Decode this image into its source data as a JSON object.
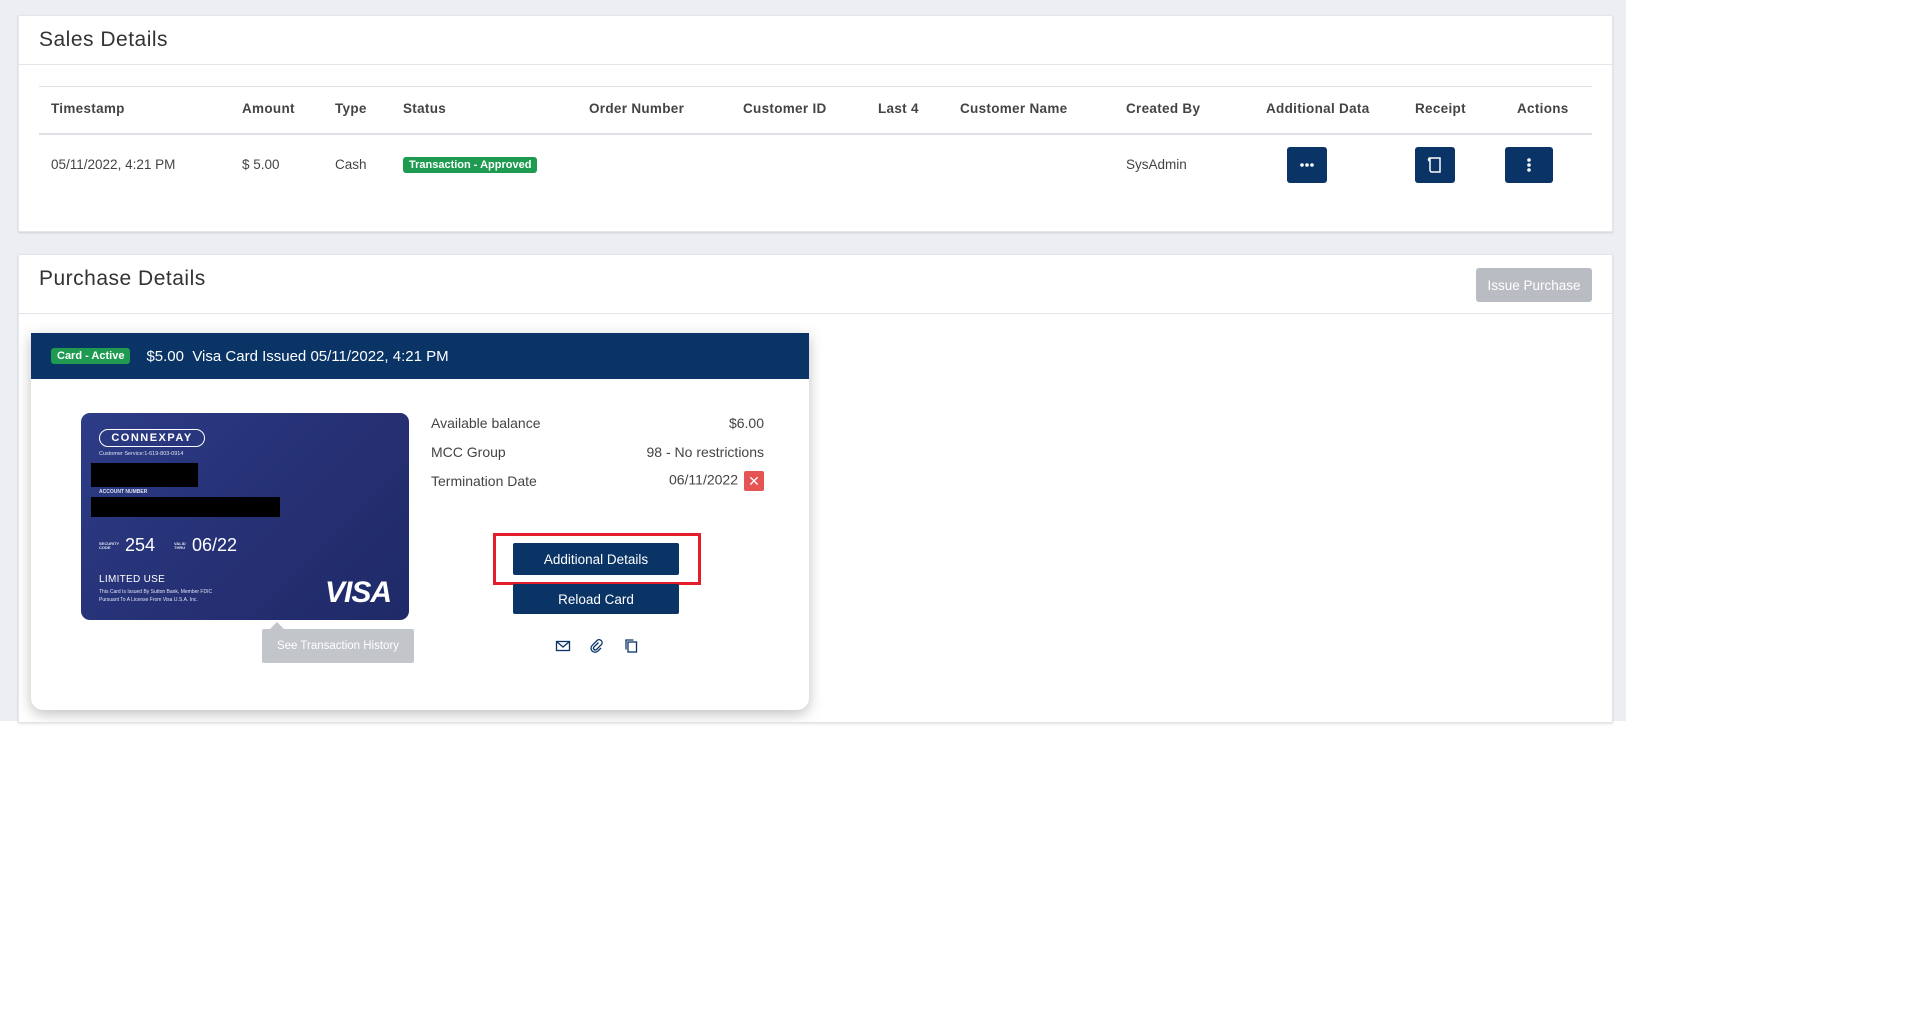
{
  "sales_details": {
    "title": "Sales Details",
    "columns": [
      "Timestamp",
      "Amount",
      "Type",
      "Status",
      "Order Number",
      "Customer ID",
      "Last 4",
      "Customer Name",
      "Created By",
      "Additional Data",
      "Receipt",
      "Actions"
    ],
    "row": {
      "timestamp": "05/11/2022, 4:21 PM",
      "amount": "$ 5.00",
      "type": "Cash",
      "status": "Transaction - Approved",
      "order_number": "",
      "customer_id": "",
      "last4": "",
      "customer_name": "",
      "created_by": "SysAdmin"
    }
  },
  "purchase_details": {
    "title": "Purchase Details",
    "issue_button": "Issue Purchase",
    "card": {
      "status_badge": "Card - Active",
      "header_text": "$5.00  Visa Card Issued 05/11/2022, 4:21 PM",
      "brand_logo": "CONNEXPAY",
      "customer_service": "Customer Service:1-619-803-0914",
      "account_number_label": "ACCOUNT NUMBER",
      "security_code_label": "SECURITY CODE",
      "security_code": "254",
      "valid_thru_label": "VALID THRU",
      "valid_thru": "06/22",
      "limited_use": "LIMITED USE",
      "issuer_line1": "This Card Is Issued By Sutton Bank, Member FDIC",
      "issuer_line2": "Pursuant To A License From Visa U.S.A. Inc.",
      "network": "VISA",
      "tooltip": "See Transaction History",
      "info": [
        {
          "label": "Available balance",
          "value": "$6.00"
        },
        {
          "label": "MCC Group",
          "value": "98 - No restrictions"
        },
        {
          "label": "Termination Date",
          "value": "06/11/2022"
        }
      ],
      "additional_details_button": "Additional Details",
      "reload_card_button": "Reload Card"
    }
  },
  "colors": {
    "navy": "#0a3466",
    "green": "#1e9b50",
    "highlight_red": "#e41d2b",
    "danger": "#e55353"
  }
}
